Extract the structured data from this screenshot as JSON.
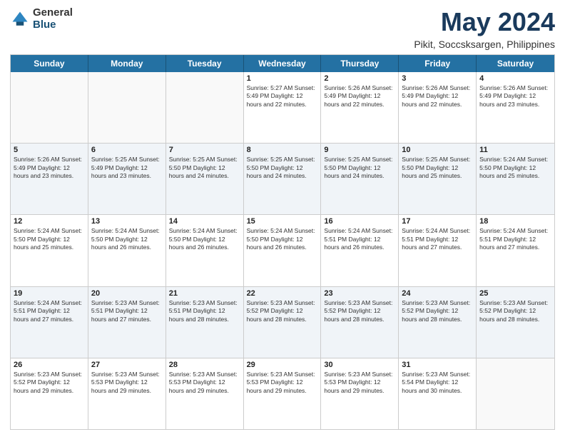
{
  "logo": {
    "general": "General",
    "blue": "Blue"
  },
  "title": "May 2024",
  "subtitle": "Pikit, Soccsksargen, Philippines",
  "days_of_week": [
    "Sunday",
    "Monday",
    "Tuesday",
    "Wednesday",
    "Thursday",
    "Friday",
    "Saturday"
  ],
  "weeks": [
    [
      {
        "day": "",
        "info": ""
      },
      {
        "day": "",
        "info": ""
      },
      {
        "day": "",
        "info": ""
      },
      {
        "day": "1",
        "info": "Sunrise: 5:27 AM\nSunset: 5:49 PM\nDaylight: 12 hours and 22 minutes."
      },
      {
        "day": "2",
        "info": "Sunrise: 5:26 AM\nSunset: 5:49 PM\nDaylight: 12 hours and 22 minutes."
      },
      {
        "day": "3",
        "info": "Sunrise: 5:26 AM\nSunset: 5:49 PM\nDaylight: 12 hours and 22 minutes."
      },
      {
        "day": "4",
        "info": "Sunrise: 5:26 AM\nSunset: 5:49 PM\nDaylight: 12 hours and 23 minutes."
      }
    ],
    [
      {
        "day": "5",
        "info": "Sunrise: 5:26 AM\nSunset: 5:49 PM\nDaylight: 12 hours and 23 minutes."
      },
      {
        "day": "6",
        "info": "Sunrise: 5:25 AM\nSunset: 5:49 PM\nDaylight: 12 hours and 23 minutes."
      },
      {
        "day": "7",
        "info": "Sunrise: 5:25 AM\nSunset: 5:50 PM\nDaylight: 12 hours and 24 minutes."
      },
      {
        "day": "8",
        "info": "Sunrise: 5:25 AM\nSunset: 5:50 PM\nDaylight: 12 hours and 24 minutes."
      },
      {
        "day": "9",
        "info": "Sunrise: 5:25 AM\nSunset: 5:50 PM\nDaylight: 12 hours and 24 minutes."
      },
      {
        "day": "10",
        "info": "Sunrise: 5:25 AM\nSunset: 5:50 PM\nDaylight: 12 hours and 25 minutes."
      },
      {
        "day": "11",
        "info": "Sunrise: 5:24 AM\nSunset: 5:50 PM\nDaylight: 12 hours and 25 minutes."
      }
    ],
    [
      {
        "day": "12",
        "info": "Sunrise: 5:24 AM\nSunset: 5:50 PM\nDaylight: 12 hours and 25 minutes."
      },
      {
        "day": "13",
        "info": "Sunrise: 5:24 AM\nSunset: 5:50 PM\nDaylight: 12 hours and 26 minutes."
      },
      {
        "day": "14",
        "info": "Sunrise: 5:24 AM\nSunset: 5:50 PM\nDaylight: 12 hours and 26 minutes."
      },
      {
        "day": "15",
        "info": "Sunrise: 5:24 AM\nSunset: 5:50 PM\nDaylight: 12 hours and 26 minutes."
      },
      {
        "day": "16",
        "info": "Sunrise: 5:24 AM\nSunset: 5:51 PM\nDaylight: 12 hours and 26 minutes."
      },
      {
        "day": "17",
        "info": "Sunrise: 5:24 AM\nSunset: 5:51 PM\nDaylight: 12 hours and 27 minutes."
      },
      {
        "day": "18",
        "info": "Sunrise: 5:24 AM\nSunset: 5:51 PM\nDaylight: 12 hours and 27 minutes."
      }
    ],
    [
      {
        "day": "19",
        "info": "Sunrise: 5:24 AM\nSunset: 5:51 PM\nDaylight: 12 hours and 27 minutes."
      },
      {
        "day": "20",
        "info": "Sunrise: 5:23 AM\nSunset: 5:51 PM\nDaylight: 12 hours and 27 minutes."
      },
      {
        "day": "21",
        "info": "Sunrise: 5:23 AM\nSunset: 5:51 PM\nDaylight: 12 hours and 28 minutes."
      },
      {
        "day": "22",
        "info": "Sunrise: 5:23 AM\nSunset: 5:52 PM\nDaylight: 12 hours and 28 minutes."
      },
      {
        "day": "23",
        "info": "Sunrise: 5:23 AM\nSunset: 5:52 PM\nDaylight: 12 hours and 28 minutes."
      },
      {
        "day": "24",
        "info": "Sunrise: 5:23 AM\nSunset: 5:52 PM\nDaylight: 12 hours and 28 minutes."
      },
      {
        "day": "25",
        "info": "Sunrise: 5:23 AM\nSunset: 5:52 PM\nDaylight: 12 hours and 28 minutes."
      }
    ],
    [
      {
        "day": "26",
        "info": "Sunrise: 5:23 AM\nSunset: 5:52 PM\nDaylight: 12 hours and 29 minutes."
      },
      {
        "day": "27",
        "info": "Sunrise: 5:23 AM\nSunset: 5:53 PM\nDaylight: 12 hours and 29 minutes."
      },
      {
        "day": "28",
        "info": "Sunrise: 5:23 AM\nSunset: 5:53 PM\nDaylight: 12 hours and 29 minutes."
      },
      {
        "day": "29",
        "info": "Sunrise: 5:23 AM\nSunset: 5:53 PM\nDaylight: 12 hours and 29 minutes."
      },
      {
        "day": "30",
        "info": "Sunrise: 5:23 AM\nSunset: 5:53 PM\nDaylight: 12 hours and 29 minutes."
      },
      {
        "day": "31",
        "info": "Sunrise: 5:23 AM\nSunset: 5:54 PM\nDaylight: 12 hours and 30 minutes."
      },
      {
        "day": "",
        "info": ""
      }
    ]
  ]
}
